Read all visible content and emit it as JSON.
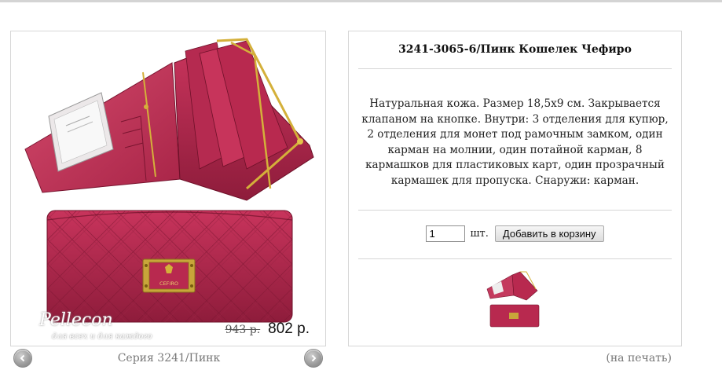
{
  "product": {
    "title": "3241-3065-6/Пинк Кошелек Чефиро",
    "description": "Натуральная кожа. Размер 18,5х9 см. Закрывается клапаном на кнопке. Внутри: 3 отделения для купюр, 2 отделения для монет под рамочным замком, один карман на молнии, один потайной карман, 8 кармашков для пластиковых карт, один прозрачный кармашек для пропуска. Снаружи: карман.",
    "old_price": "943 р.",
    "new_price": "802 р.",
    "brand_plate": "CEFIRO"
  },
  "watermark": {
    "name": "Pellecon",
    "slogan": "для всех и для каждого"
  },
  "gallery": {
    "series_label": "Серия 3241/Пинк",
    "prev_icon": "chevron-left-icon",
    "next_icon": "chevron-right-icon"
  },
  "cart": {
    "quantity": "1",
    "unit": "шт.",
    "add_label": "Добавить в корзину"
  },
  "links": {
    "print": "(на печать)"
  },
  "colors": {
    "wallet": "#b8294f",
    "wallet_dark": "#8e1c3b",
    "gold": "#d4b03a",
    "border": "#d6d6d6",
    "muted_text": "#777777"
  }
}
